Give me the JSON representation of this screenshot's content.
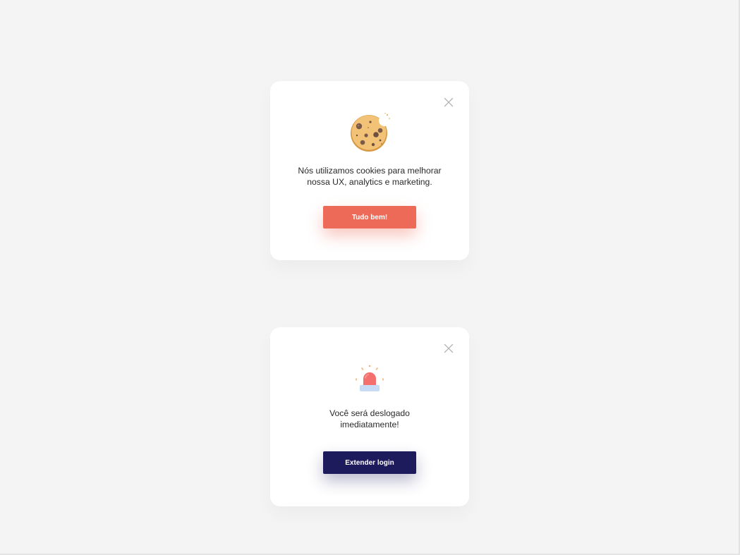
{
  "cookie_modal": {
    "icon": "cookie-icon",
    "close_icon": "close-icon",
    "message": "Nós utilizamos cookies para melhorar\nnossa UX, analytics e marketing.",
    "button_label": "Tudo bem!",
    "button_color": "#ee6a58"
  },
  "logout_modal": {
    "icon": "siren-alarm-icon",
    "close_icon": "close-icon",
    "message": "Você será deslogado\nimediatamente!",
    "button_label": "Extender login",
    "button_color": "#1e1b5c"
  },
  "colors": {
    "page_background": "#f4f4f4",
    "card_background": "#ffffff",
    "text": "#2a2a2a",
    "close_icon": "#b3b3b3"
  }
}
